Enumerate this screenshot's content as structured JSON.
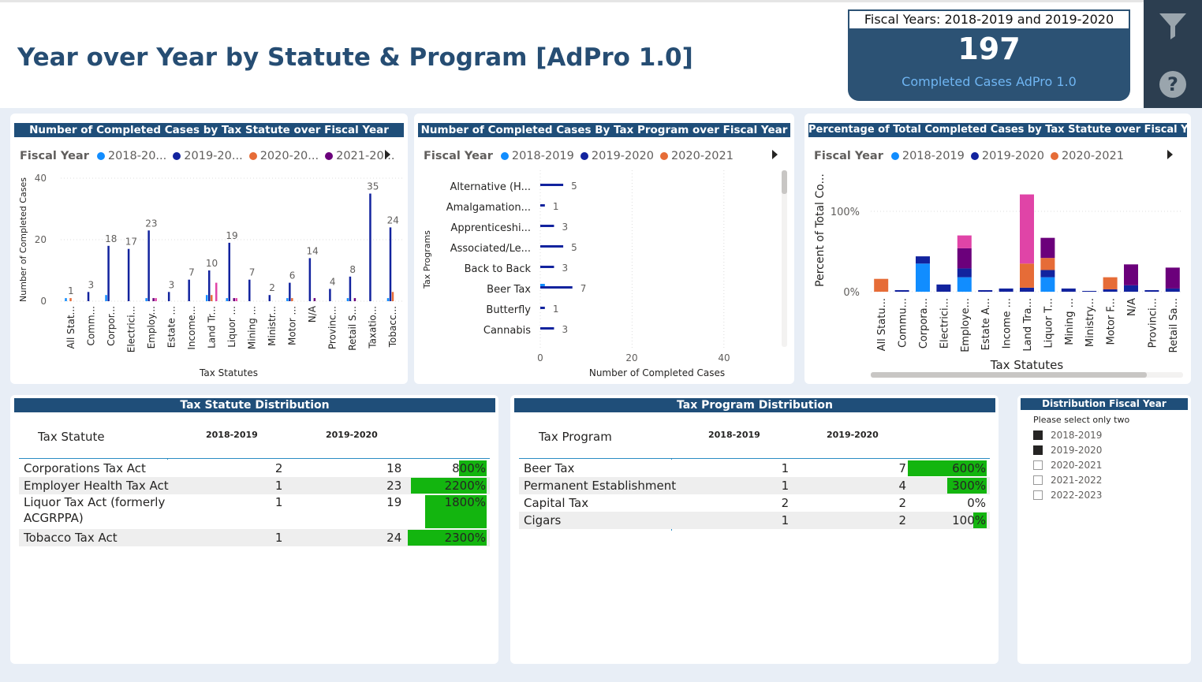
{
  "header": {
    "title": "Year over Year by Statute & Program [AdPro 1.0]",
    "kpi_label": "Fiscal Years: 2018-2019 and 2019-2020",
    "kpi_value": "197",
    "kpi_caption": "Completed Cases AdPro 1.0",
    "filter_icon": "funnel-icon",
    "help_icon": "question-icon"
  },
  "colors": {
    "fy2018": "#118dff",
    "fy2019": "#12239e",
    "fy2020": "#e66c37",
    "fy2021": "#6b007b",
    "fy2022": "#e044a7",
    "header_blue": "#1f4e79",
    "bar_green": "#13b50f"
  },
  "statute_chart": {
    "title": "Number of Completed Cases by Tax Statute over Fiscal Year",
    "legend_title": "Fiscal Year",
    "legend": [
      "2018-20...",
      "2019-20...",
      "2020-20...",
      "2021-20..."
    ],
    "ylabel": "Number of Completed Cases",
    "xlabel": "Tax Statutes",
    "y_ticks": [
      "0",
      "20",
      "40"
    ]
  },
  "program_chart": {
    "title": "Number of Completed Cases By Tax Program over Fiscal Year",
    "legend_title": "Fiscal Year",
    "legend": [
      "2018-2019",
      "2019-2020",
      "2020-2021"
    ],
    "ylabel": "Tax Programs",
    "xlabel": "Number of Completed Cases",
    "x_ticks": [
      "0",
      "20",
      "40"
    ]
  },
  "percent_chart": {
    "title": "Percentage of Total Completed Cases by Tax Statute over Fiscal Year",
    "legend_title": "Fiscal Year",
    "legend": [
      "2018-2019",
      "2019-2020",
      "2020-2021"
    ],
    "ylabel": "Percent of Total Co...",
    "xlabel": "Tax Statutes",
    "y_ticks": [
      "0%",
      "100%"
    ]
  },
  "chart_data": [
    {
      "type": "bar",
      "title": "Number of Completed Cases by Tax Statute over Fiscal Year",
      "xlabel": "Tax Statutes",
      "ylabel": "Number of Completed Cases",
      "ylim": [
        0,
        40
      ],
      "categories": [
        "All Stat...",
        "Comm...",
        "Corpor...",
        "Electrici...",
        "Employ...",
        "Estate ...",
        "Income...",
        "Land Tr...",
        "Liquor ...",
        "Mining ...",
        "Ministr...",
        "Motor ...",
        "N/A",
        "Provinc...",
        "Retail S...",
        "Taxatio...",
        "Tobacc..."
      ],
      "series": [
        {
          "name": "2018-20...",
          "values": [
            1,
            0,
            2,
            0,
            1,
            0,
            0,
            2,
            1,
            0,
            0,
            1,
            0,
            0,
            1,
            0,
            1
          ]
        },
        {
          "name": "2019-20...",
          "values": [
            0,
            3,
            18,
            17,
            23,
            3,
            7,
            10,
            19,
            7,
            2,
            6,
            14,
            4,
            8,
            35,
            24
          ]
        },
        {
          "name": "2020-20...",
          "values": [
            1,
            0,
            0,
            0,
            0,
            0,
            0,
            2,
            0,
            0,
            0,
            1,
            0,
            0,
            0,
            0,
            3
          ]
        },
        {
          "name": "2021-20...",
          "values": [
            0,
            0,
            0,
            0,
            1,
            0,
            0,
            0,
            1,
            0,
            0,
            0,
            1,
            0,
            1,
            0,
            0
          ]
        },
        {
          "name": "",
          "values": [
            0,
            0,
            0,
            0,
            1,
            0,
            0,
            6,
            1,
            0,
            0,
            0,
            0,
            0,
            0,
            0,
            0
          ]
        }
      ],
      "data_labels": [
        "1",
        "3",
        "18",
        "17",
        "23",
        "3",
        "7",
        "10",
        "19",
        "7",
        "2",
        "6",
        "14",
        "4",
        "8",
        "35",
        "24"
      ],
      "extra_labels": [
        "2",
        "1",
        "1",
        "2",
        "6",
        "1",
        "1",
        "1",
        "1",
        "1",
        "1",
        "3"
      ],
      "grid": true
    },
    {
      "type": "bar",
      "title": "Number of Completed Cases By Tax Program over Fiscal Year",
      "xlabel": "Number of Completed Cases",
      "ylabel": "Tax Programs",
      "xlim": [
        0,
        50
      ],
      "categories": [
        "Alternative (H...",
        "Amalgamation...",
        "Apprenticeshi...",
        "Associated/Le...",
        "Back to Back",
        "Beer Tax",
        "Butterfly",
        "Cannabis"
      ],
      "series": [
        {
          "name": "2018-2019",
          "values": [
            0,
            0,
            0,
            0,
            0,
            1,
            0,
            0
          ]
        },
        {
          "name": "2019-2020",
          "values": [
            5,
            1,
            3,
            5,
            3,
            7,
            1,
            3
          ]
        },
        {
          "name": "2020-2021",
          "values": [
            0,
            0,
            0,
            0,
            0,
            0,
            0,
            0
          ]
        }
      ],
      "data_labels": [
        "5",
        "1",
        "3",
        "5",
        "3",
        "7",
        "1",
        "3"
      ],
      "extra_labels": [
        "1"
      ],
      "grid": true
    },
    {
      "type": "bar",
      "title": "Percentage of Total Completed Cases by Tax Statute over Fiscal Year",
      "xlabel": "Tax Statutes",
      "ylabel": "Percent of Total Co...",
      "ylim": [
        0,
        130
      ],
      "categories": [
        "All Statu...",
        "Commu...",
        "Corpora...",
        "Electrici...",
        "Employe...",
        "Estate A...",
        "Income ...",
        "Land Tra...",
        "Liquor T...",
        "Mining ...",
        "Ministry...",
        "Motor F...",
        "N/A",
        "Provinci...",
        "Retail Sa..."
      ],
      "series": [
        {
          "name": "2018-2019",
          "values": [
            0,
            0,
            35,
            0,
            18,
            0,
            0,
            0,
            18,
            0,
            0,
            0,
            0,
            0,
            0
          ]
        },
        {
          "name": "2019-2020",
          "values": [
            0,
            2,
            9,
            9,
            11,
            2,
            4,
            5,
            9,
            4,
            1,
            3,
            8,
            2,
            4
          ]
        },
        {
          "name": "2020-2021",
          "values": [
            16,
            0,
            0,
            0,
            0,
            0,
            0,
            30,
            15,
            0,
            0,
            15,
            0,
            0,
            0
          ]
        },
        {
          "name": "",
          "values": [
            0,
            0,
            0,
            0,
            25,
            0,
            0,
            0,
            25,
            0,
            0,
            0,
            26,
            0,
            26
          ]
        },
        {
          "name": "",
          "values": [
            0,
            0,
            0,
            0,
            16,
            0,
            0,
            86,
            0,
            0,
            0,
            0,
            0,
            0,
            0
          ]
        }
      ],
      "grid": true
    }
  ],
  "statute_matrix": {
    "title": "Tax Statute Distribution",
    "col_first": "Tax Statute",
    "col_a": "2018-2019",
    "col_b": "2019-2020",
    "rows": [
      {
        "name": "Corporations Tax Act",
        "a": "2",
        "b": "18",
        "pct": "800%",
        "frac": 0.348
      },
      {
        "name": "Employer Health Tax Act",
        "a": "1",
        "b": "23",
        "pct": "2200%",
        "frac": 0.957
      },
      {
        "name": "Liquor Tax Act (formerly ACGRPPA)",
        "a": "1",
        "b": "19",
        "pct": "1800%",
        "frac": 0.783
      },
      {
        "name": "Tobacco Tax Act",
        "a": "1",
        "b": "24",
        "pct": "2300%",
        "frac": 1.0
      }
    ]
  },
  "program_matrix": {
    "title": "Tax Program Distribution",
    "col_first": "Tax Program",
    "col_a": "2018-2019",
    "col_b": "2019-2020",
    "rows": [
      {
        "name": "Beer Tax",
        "a": "1",
        "b": "7",
        "pct": "600%",
        "frac": 1.0
      },
      {
        "name": "Permanent Establishment",
        "a": "1",
        "b": "4",
        "pct": "300%",
        "frac": 0.5
      },
      {
        "name": "Capital Tax",
        "a": "2",
        "b": "2",
        "pct": "0%",
        "frac": 0.0
      },
      {
        "name": "Cigars",
        "a": "1",
        "b": "2",
        "pct": "100%",
        "frac": 0.167
      }
    ]
  },
  "slicer": {
    "title": "Distribution Fiscal Year Selector",
    "note": "Please select only two",
    "items": [
      {
        "label": "2018-2019",
        "checked": true
      },
      {
        "label": "2019-2020",
        "checked": true
      },
      {
        "label": "2020-2021",
        "checked": false
      },
      {
        "label": "2021-2022",
        "checked": false
      },
      {
        "label": "2022-2023",
        "checked": false
      }
    ]
  }
}
